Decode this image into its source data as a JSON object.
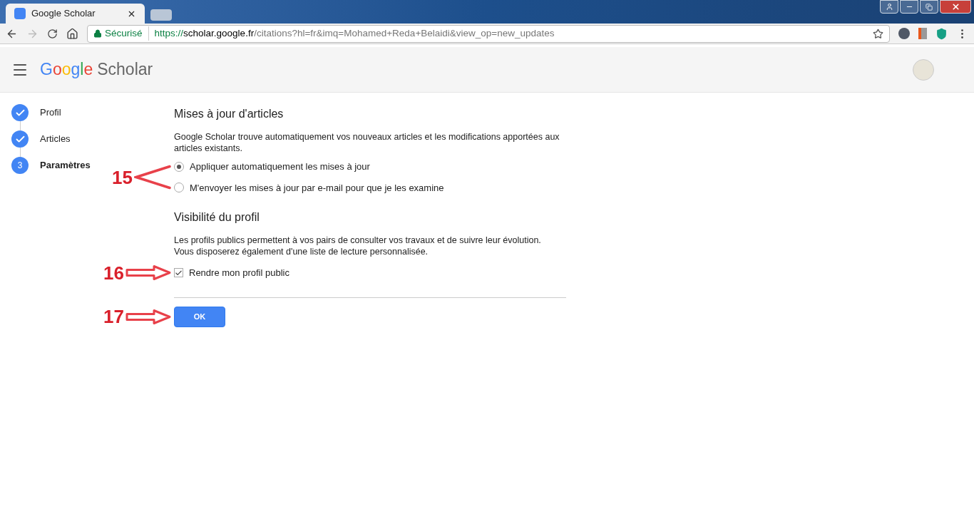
{
  "browser": {
    "tabs": [
      {
        "title": "Google Scholar",
        "selected": true
      },
      {
        "selected": false
      }
    ],
    "secure_label": "Sécurisé",
    "url": {
      "scheme": "https://",
      "host": "scholar.google.fr",
      "rest": "/citations?hl=fr&imq=Mohamed+Reda+Belaidi&view_op=new_updates"
    }
  },
  "header": {
    "logo_google": "Google",
    "logo_product": "Scholar"
  },
  "steps": [
    {
      "label": "Profil",
      "kind": "done",
      "selected": false
    },
    {
      "label": "Articles",
      "kind": "done",
      "selected": false
    },
    {
      "label": "Paramètres",
      "kind": "current",
      "number": "3",
      "selected": true
    }
  ],
  "updates": {
    "title": "Mises à jour d'articles",
    "description": "Google Scholar trouve automatiquement vos nouveaux articles et les modifications apportées aux articles existants.",
    "options": [
      {
        "label": "Appliquer automatiquement les mises à jour",
        "selected": true
      },
      {
        "label": "M'envoyer les mises à jour par e-mail pour que je les examine",
        "selected": false
      }
    ],
    "annotation": {
      "label": "15",
      "kind": "chevron"
    }
  },
  "visibility": {
    "title": "Visibilité du profil",
    "description": "Les profils publics permettent à vos pairs de consulter vos travaux et de suivre leur évolution.\nVous disposerez également d'une liste de lecture personnalisée.",
    "checkbox": {
      "label": "Rendre mon profil public",
      "checked": true
    },
    "annotation": {
      "label": "16",
      "kind": "arrow"
    }
  },
  "ok_button": {
    "label": "OK",
    "annotation": {
      "label": "17",
      "kind": "arrow"
    }
  }
}
